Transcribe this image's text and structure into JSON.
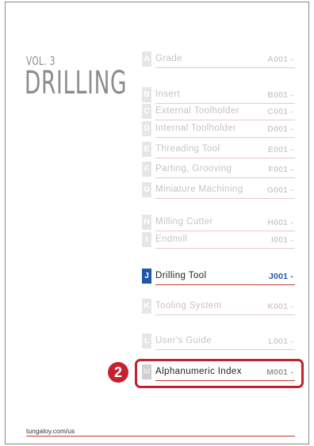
{
  "cover": {
    "volume": "VOL. 3",
    "title": "DRILLING"
  },
  "index": [
    {
      "letter": "A",
      "label": "Grade",
      "code": "A001 -",
      "state": "inactive"
    },
    {
      "letter": "B",
      "label": "Insert",
      "code": "B001 -",
      "state": "inactive"
    },
    {
      "letter": "C",
      "label": "External Toolholder",
      "code": "C001 -",
      "state": "inactive"
    },
    {
      "letter": "D",
      "label": "Internal Toolholder",
      "code": "D001 -",
      "state": "inactive"
    },
    {
      "letter": "E",
      "label": "Threading Tool",
      "code": "E001 -",
      "state": "inactive"
    },
    {
      "letter": "F",
      "label": "Parting, Grooving",
      "code": "F001 -",
      "state": "inactive"
    },
    {
      "letter": "G",
      "label": "Miniature Machining",
      "code": "G001 -",
      "state": "inactive"
    },
    {
      "letter": "H",
      "label": "Milling Cutter",
      "code": "H001 -",
      "state": "inactive"
    },
    {
      "letter": "I",
      "label": "Endmill",
      "code": "I001 -",
      "state": "inactive"
    },
    {
      "letter": "J",
      "label": "Drilling Tool",
      "code": "J001 -",
      "state": "active"
    },
    {
      "letter": "K",
      "label": "Tooling System",
      "code": "K001 -",
      "state": "inactive"
    },
    {
      "letter": "L",
      "label": "User's Guide",
      "code": "L001 -",
      "state": "inactive"
    },
    {
      "letter": "M",
      "label": "Alphanumeric Index",
      "code": "M001 -",
      "state": "index"
    }
  ],
  "callout": {
    "number": "2"
  },
  "footer": {
    "url": "tungaloy.com/us"
  },
  "colors": {
    "accent_blue": "#1f56a6",
    "accent_red": "#c4202e",
    "muted": "#c4c4c4"
  }
}
